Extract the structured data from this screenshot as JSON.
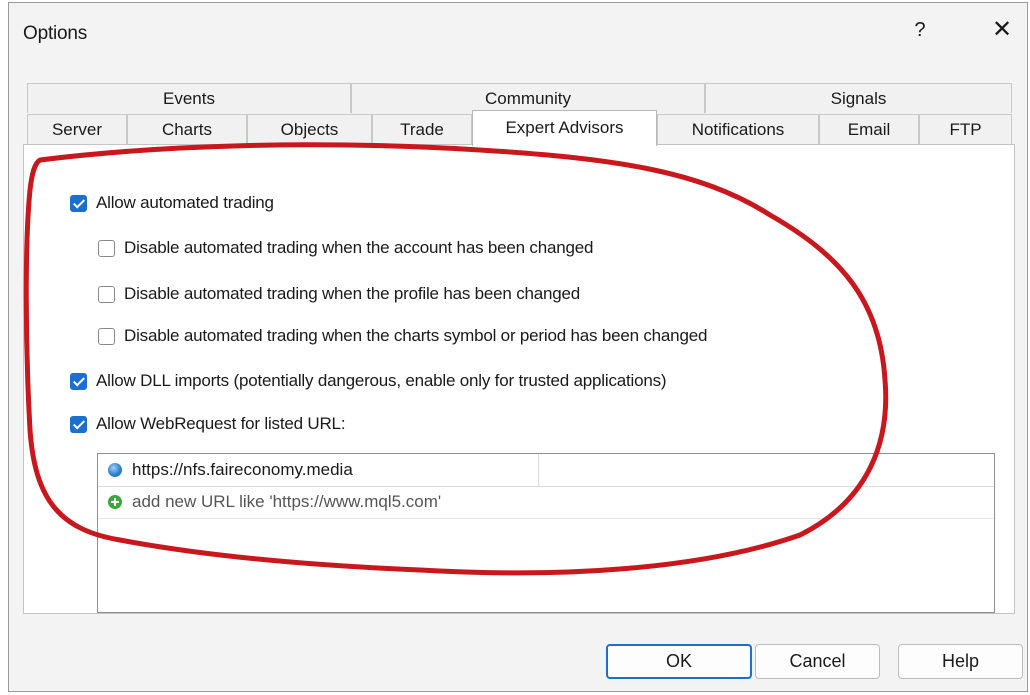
{
  "window": {
    "title": "Options",
    "help_glyph": "?",
    "close_glyph": "✕"
  },
  "tabs": {
    "row_top": [
      "Events",
      "Community",
      "Signals"
    ],
    "row_bottom": [
      "Server",
      "Charts",
      "Objects",
      "Trade",
      "Expert Advisors",
      "Notifications",
      "Email",
      "FTP"
    ],
    "active": "Expert Advisors"
  },
  "options": [
    {
      "label": "Allow automated trading",
      "checked": true
    },
    {
      "label": "Disable automated trading when the account has been changed",
      "checked": false
    },
    {
      "label": "Disable automated trading when the profile has been changed",
      "checked": false
    },
    {
      "label": "Disable automated trading when the charts symbol or period has been changed",
      "checked": false
    },
    {
      "label": "Allow DLL imports (potentially dangerous, enable only for trusted applications)",
      "checked": true
    },
    {
      "label": "Allow WebRequest for listed URL:",
      "checked": true
    }
  ],
  "url_list": {
    "entries": [
      "https://nfs.faireconomy.media"
    ],
    "add_placeholder": "add new URL like 'https://www.mql5.com'"
  },
  "buttons": {
    "ok": "OK",
    "cancel": "Cancel",
    "help": "Help"
  },
  "colors": {
    "accent": "#1a6fcf",
    "annotation": "#c8181e"
  }
}
